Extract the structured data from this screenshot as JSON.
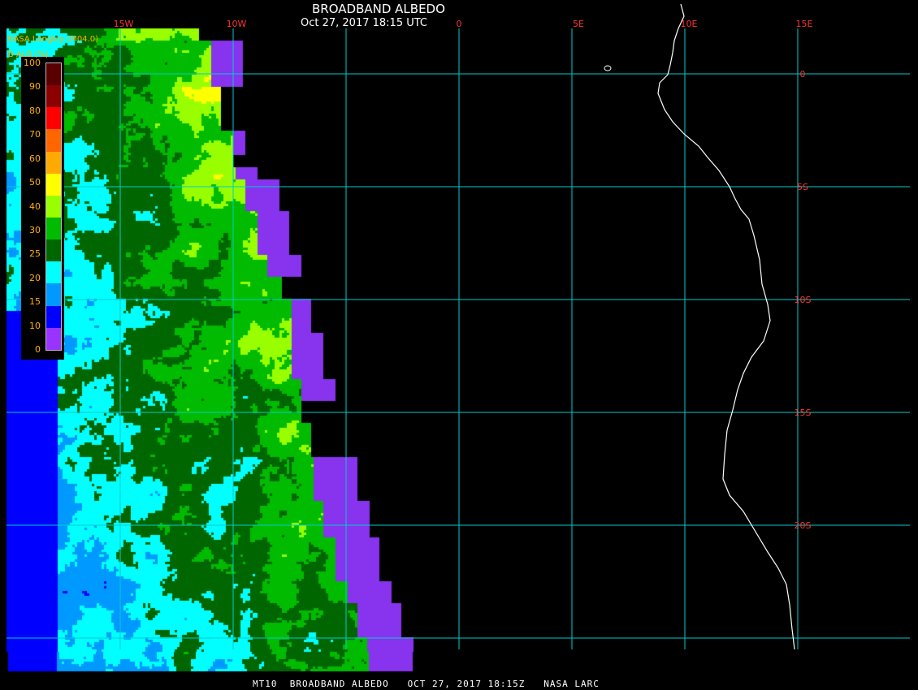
{
  "header": {
    "title": "BROADBAND ALBEDO",
    "datetime": "Oct 27, 2017 18:15 UTC",
    "credit": "NASA Langley (M04.0)"
  },
  "footer": {
    "text": "MT10  BROADBAND ALBEDO   OCT 27, 2017 18:15Z   NASA LARC"
  },
  "legend": {
    "title": "B ALB (%)",
    "ticks": [
      "100",
      "90",
      "80",
      "70",
      "60",
      "50",
      "40",
      "30",
      "25",
      "20",
      "15",
      "10",
      "0"
    ],
    "bins": [
      {
        "color": "#5a0000"
      },
      {
        "color": "#8b0000"
      },
      {
        "color": "#ff0000"
      },
      {
        "color": "#ff6600"
      },
      {
        "color": "#ffaa00"
      },
      {
        "color": "#ffff00"
      },
      {
        "color": "#99ff00"
      },
      {
        "color": "#00bb00"
      },
      {
        "color": "#006600"
      },
      {
        "color": "#00ffff"
      },
      {
        "color": "#0099ff"
      },
      {
        "color": "#0000ff"
      },
      {
        "color": "#9933ff"
      }
    ]
  },
  "grid": {
    "lon_labels": [
      "15W",
      "10W",
      "0",
      "5E",
      "10E",
      "15E"
    ],
    "lat_labels": [
      "0",
      "5S",
      "10S",
      "15S",
      "20S"
    ],
    "line_color": "#00cccc",
    "label_color": "#ff3333"
  },
  "colors": {
    "background": "#000000",
    "no_data": "#8833ee",
    "coast": "#ffffff"
  }
}
